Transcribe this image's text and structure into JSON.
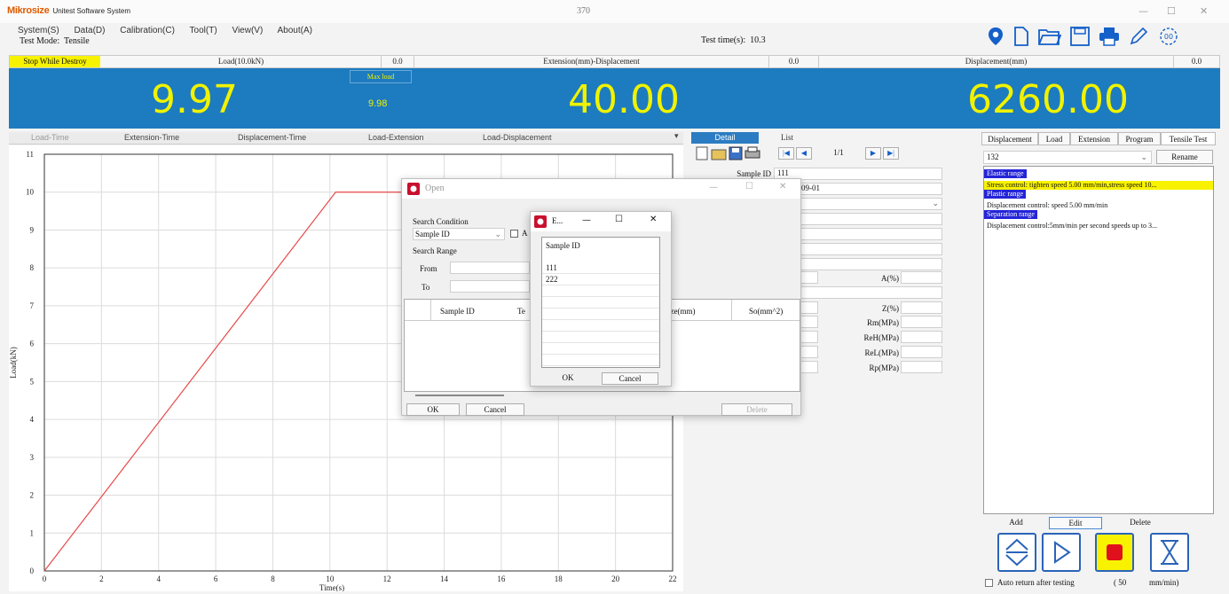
{
  "app": {
    "logo": "Mikrosize",
    "system_name": "Unitest Software System",
    "window_title": "370",
    "test_mode_label": "Test Mode:",
    "test_mode_value": "Tensile",
    "test_time_label": "Test time(s):",
    "test_time_value": "10.3"
  },
  "menu": [
    "System(S)",
    "Data(D)",
    "Calibration(C)",
    "Tool(T)",
    "View(V)",
    "About(A)"
  ],
  "header_row": {
    "stop_label": "Stop While Destroy",
    "load_label": "Load(10.0kN)",
    "load_zero": "0.0",
    "extension_label": "Extension(mm)-Displacement",
    "extension_zero": "0.0",
    "displacement_label": "Displacement(mm)",
    "displacement_zero": "0.0"
  },
  "display": {
    "load": "9.97",
    "max_load_label": "Max load",
    "max_load": "9.98",
    "extension": "40.00",
    "displacement": "6260.00"
  },
  "chart_tabs": [
    "Load-Time",
    "Extension-Time",
    "Displacement-Time",
    "Load-Extension",
    "Load-Displacement"
  ],
  "chart_data": {
    "type": "line",
    "xlabel": "Time(s)",
    "ylabel": "Load(kN)",
    "xlim": [
      0,
      22
    ],
    "ylim": [
      0,
      11
    ],
    "xticks": [
      0,
      2,
      4,
      6,
      8,
      10,
      12,
      14,
      16,
      18,
      20,
      22
    ],
    "yticks": [
      0,
      1,
      2,
      3,
      4,
      5,
      6,
      7,
      8,
      9,
      10,
      11
    ],
    "grid": true,
    "series": [
      {
        "color": "#e84a4a",
        "x": [
          0,
          10.2,
          12.5
        ],
        "y": [
          0,
          10,
          10
        ]
      }
    ]
  },
  "detail": {
    "tab_detail": "Detail",
    "tab_list": "List",
    "page": "1/1",
    "sample_id_label": "Sample ID",
    "sample_id_value": "111",
    "date_value": "09-01",
    "a_label": "A(%)",
    "z_label": "Z(%)",
    "rm_label": "Rm(MPa)",
    "reh_label": "ReH(MPa)",
    "rel_label": "ReL(MPa)",
    "rp_label": "Rp(MPa)"
  },
  "right_panel": {
    "tabs": [
      "Displacement",
      "Load",
      "Extension",
      "Program",
      "Tensile Test"
    ],
    "program_select": "132",
    "rename_button": "Rename",
    "items": [
      {
        "text": "Elastic range",
        "style": "hl-blue"
      },
      {
        "text": "Stress control: tighten speed 5.00 mm/min,stress speed 10...",
        "style": "hl-yellow"
      },
      {
        "text": "Plastic range",
        "style": "hl-blue"
      },
      {
        "text": "Displacement control: speed 5.00 mm/min",
        "style": ""
      },
      {
        "text": "Separation range",
        "style": "hl-blue"
      },
      {
        "text": "Displacement control:5mm/min per second speeds up to 3...",
        "style": ""
      }
    ],
    "add_button": "Add",
    "edit_button": "Edit",
    "delete_button": "Delete",
    "auto_return_label": "Auto return after testing",
    "speed_value": "( 50",
    "speed_unit": "mm/min)"
  },
  "open_dialog": {
    "title": "Open",
    "search_condition_label": "Search Condition",
    "condition_value": "Sample ID",
    "checkbox_label": "A",
    "search_range_label": "Search Range",
    "from_label": "From",
    "to_label": "To",
    "col_sample_id": "Sample ID",
    "col_te": "Te",
    "col_size": "Size(mm)",
    "col_so": "So(mm^2)",
    "ok_button": "OK",
    "cancel_button": "Cancel",
    "delete_button": "Delete"
  },
  "sub_dialog": {
    "title": "E...",
    "header": "Sample ID",
    "items": [
      "111",
      "222"
    ],
    "ok_button": "OK",
    "cancel_button": "Cancel"
  }
}
